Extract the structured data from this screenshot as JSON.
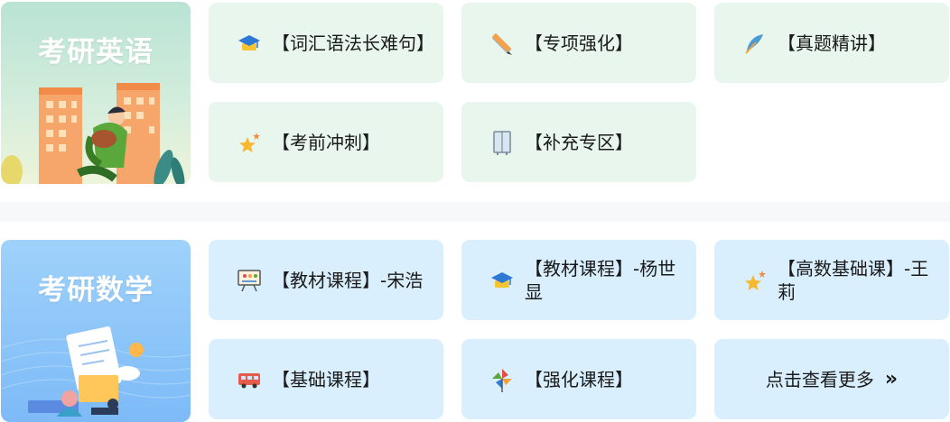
{
  "english": {
    "title": "考研英语",
    "cards": [
      {
        "label": "【词汇语法长难句】",
        "icon": "graduation-cap-icon"
      },
      {
        "label": "【专项强化】",
        "icon": "ruler-pencil-icon"
      },
      {
        "label": "【真题精讲】",
        "icon": "feather-quill-icon"
      },
      {
        "label": "【考前冲刺】",
        "icon": "stars-icon"
      },
      {
        "label": "【补充专区】",
        "icon": "cabinet-icon"
      }
    ]
  },
  "math": {
    "title": "考研数学",
    "cards": [
      {
        "label": "【教材课程】-宋浩",
        "icon": "presentation-board-icon"
      },
      {
        "label": "【教材课程】-杨世显",
        "icon": "graduation-cap-icon"
      },
      {
        "label": "【高数基础课】-王莉",
        "icon": "stars-icon"
      },
      {
        "label": "【基础课程】",
        "icon": "bus-icon"
      },
      {
        "label": "【强化课程】",
        "icon": "pinwheel-icon"
      }
    ],
    "more": {
      "label": "点击查看更多",
      "chevron": "»"
    }
  }
}
